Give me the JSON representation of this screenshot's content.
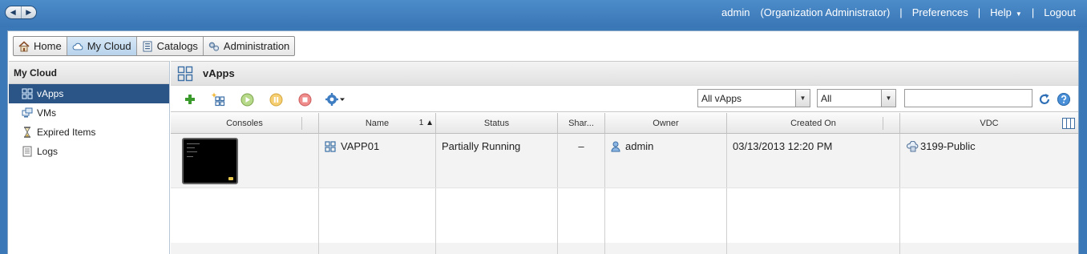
{
  "topbar": {
    "nav_back": "◀",
    "nav_forward": "▶",
    "user": "admin",
    "role": "(Organization Administrator)",
    "separator": "|",
    "preferences": "Preferences",
    "help": "Help",
    "help_caret": "▼",
    "logout": "Logout"
  },
  "tabs": [
    {
      "label": "Home",
      "icon": "house-icon"
    },
    {
      "label": "My Cloud",
      "icon": "cloud-icon"
    },
    {
      "label": "Catalogs",
      "icon": "catalog-icon"
    },
    {
      "label": "Administration",
      "icon": "gears-icon"
    }
  ],
  "sidebar": {
    "title": "My Cloud",
    "items": [
      {
        "label": "vApps",
        "icon": "vapp-icon"
      },
      {
        "label": "VMs",
        "icon": "vm-icon"
      },
      {
        "label": "Expired Items",
        "icon": "hourglass-icon"
      },
      {
        "label": "Logs",
        "icon": "log-icon"
      }
    ]
  },
  "content": {
    "title": "vApps",
    "toolbar": {
      "filter1": "All vApps",
      "filter2": "All",
      "search_value": ""
    }
  },
  "table": {
    "headers": [
      "Consoles",
      "Name",
      "Status",
      "Shar...",
      "Owner",
      "Created On",
      "VDC"
    ],
    "sort_indicator": "1 ▲",
    "rows": [
      {
        "name": "VAPP01",
        "status": "Partially Running",
        "shared": "–",
        "owner": "admin",
        "created_on": "03/13/2013 12:20 PM",
        "vdc": "3199-Public"
      }
    ]
  },
  "colors": {
    "topbar": "#3d7bbb",
    "selected": "#2a5586",
    "add_green": "#3a9a2c",
    "power_on": "#9ec95a",
    "suspend": "#f2b945",
    "power_off": "#e06060",
    "refresh_blue": "#2f6fb6"
  }
}
